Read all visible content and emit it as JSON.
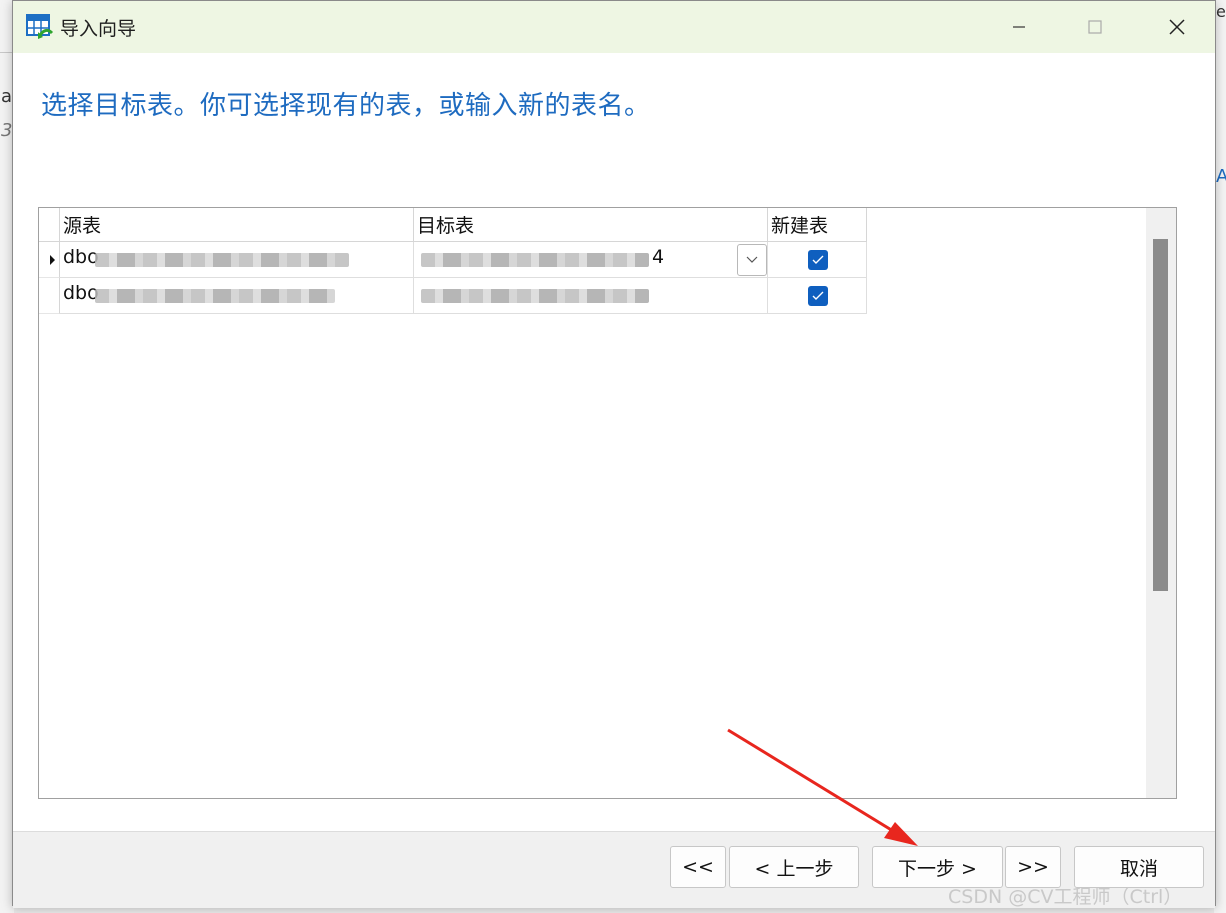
{
  "window": {
    "title": "导入向导",
    "icon": "table-import-icon",
    "minimize_icon": "minimize-icon",
    "maximize_icon": "maximize-icon",
    "close_icon": "close-icon"
  },
  "heading": "选择目标表。你可选择现有的表，或输入新的表名。",
  "grid": {
    "columns": [
      "源表",
      "目标表",
      "新建表"
    ],
    "rows": [
      {
        "source": "dbo",
        "target_suffix": "4",
        "new_table": true,
        "current": true
      },
      {
        "source": "dbo",
        "target_suffix": "",
        "new_table": true,
        "current": false
      }
    ]
  },
  "footer": {
    "first_label": "<<",
    "back_label": "< 上一步",
    "next_label": "下一步 >",
    "last_label": ">>",
    "cancel_label": "取消"
  },
  "background": {
    "left_chars": [
      "a",
      "3"
    ],
    "right_chars": [
      "e",
      "A"
    ]
  },
  "watermark": "CSDN @CV工程师（Ctrl）",
  "colors": {
    "titlebar": "#eef6e3",
    "heading": "#1e6bc0",
    "checkbox": "#0f5fbf",
    "annotation_arrow": "#e8261e"
  }
}
